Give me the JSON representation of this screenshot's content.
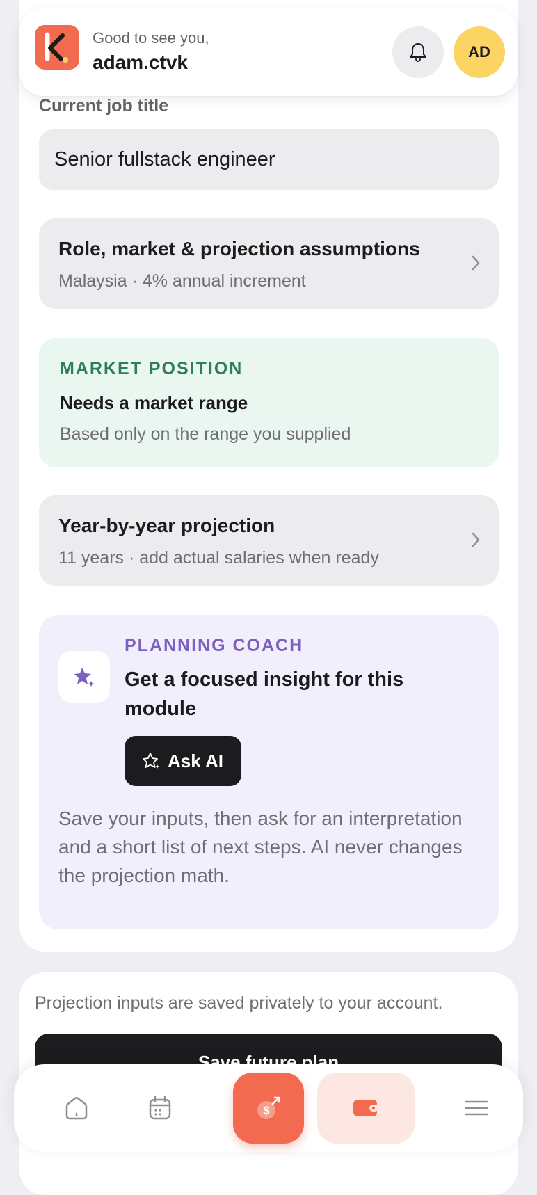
{
  "header": {
    "greeting": "Good to see you,",
    "username": "adam.ctvk",
    "avatar_initials": "AD",
    "logo_icon": "app-logo-k",
    "bell_icon": "bell-icon"
  },
  "form": {
    "job_title_label": "Current job title",
    "job_title_value": "Senior fullstack engineer"
  },
  "assumptions": {
    "title": "Role, market & projection assumptions",
    "subtitle": "Malaysia · 4% annual increment"
  },
  "market_position": {
    "eyebrow": "MARKET POSITION",
    "title": "Needs a market range",
    "subtitle": "Based only on the range you supplied"
  },
  "projection": {
    "title": "Year-by-year projection",
    "subtitle": "11 years · add actual salaries when ready"
  },
  "coach": {
    "eyebrow": "PLANNING COACH",
    "title": "Get a focused insight for this module",
    "button_label": "Ask AI",
    "description": "Save your inputs, then ask for an interpretation and a short list of next steps. AI never changes the projection math."
  },
  "footer": {
    "note": "Projection inputs are saved privately to your account.",
    "save_button": "Save future plan"
  },
  "tabbar": {
    "items": [
      "home-icon",
      "calendar-icon",
      "money-growth-icon",
      "wallet-icon",
      "menu-icon"
    ],
    "active": "money-growth-icon"
  },
  "colors": {
    "brand": "#f26a4f",
    "market_accent": "#2e7d5b",
    "coach_accent": "#7d5fc2",
    "avatar_bg": "#fcd464"
  }
}
